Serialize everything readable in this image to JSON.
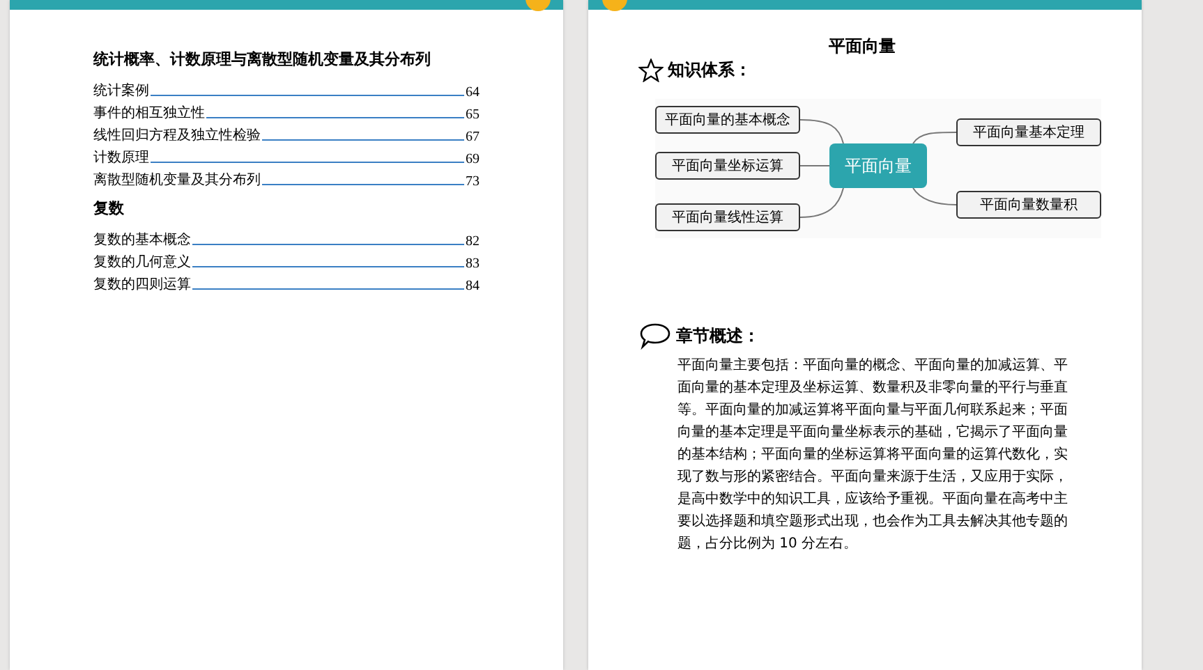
{
  "left_page": {
    "toc_sections": [
      {
        "heading": "统计概率、计数原理与离散型随机变量及其分布列",
        "entries": [
          {
            "title": "统计案例",
            "page": "64"
          },
          {
            "title": "事件的相互独立性",
            "page": "65"
          },
          {
            "title": "线性回归方程及独立性检验",
            "page": "67"
          },
          {
            "title": "计数原理",
            "page": "69"
          },
          {
            "title": "离散型随机变量及其分布列",
            "page": "73"
          }
        ]
      },
      {
        "heading": "复数",
        "entries": [
          {
            "title": "复数的基本概念",
            "page": "82"
          },
          {
            "title": "复数的几何意义",
            "page": "83"
          },
          {
            "title": "复数的四则运算",
            "page": "84"
          }
        ]
      }
    ]
  },
  "right_page": {
    "title": "平面向量",
    "knowledge_heading": "知识体系：",
    "mind_map": {
      "center": "平面向量",
      "left_nodes": [
        "平面向量的基本概念",
        "平面向量坐标运算",
        "平面向量线性运算"
      ],
      "right_nodes": [
        "平面向量基本定理",
        "平面向量数量积"
      ]
    },
    "overview_heading": "章节概述：",
    "overview_text": "平面向量主要包括：平面向量的概念、平面向量的加减运算、平面向量的基本定理及坐标运算、数量积及非零向量的平行与垂直等。平面向量的加减运算将平面向量与平面几何联系起来；平面向量的基本定理是平面向量坐标表示的基础，它揭示了平面向量的基本结构；平面向量的坐标运算将平面向量的运算代数化，实现了数与形的紧密结合。平面向量来源于生活，又应用于实际，是高中数学中的知识工具，应该给予重视。平面向量在高考中主要以选择题和填空题形式出现，也会作为工具去解决其他专题的题，占分比例为 10 分左右。"
  }
}
